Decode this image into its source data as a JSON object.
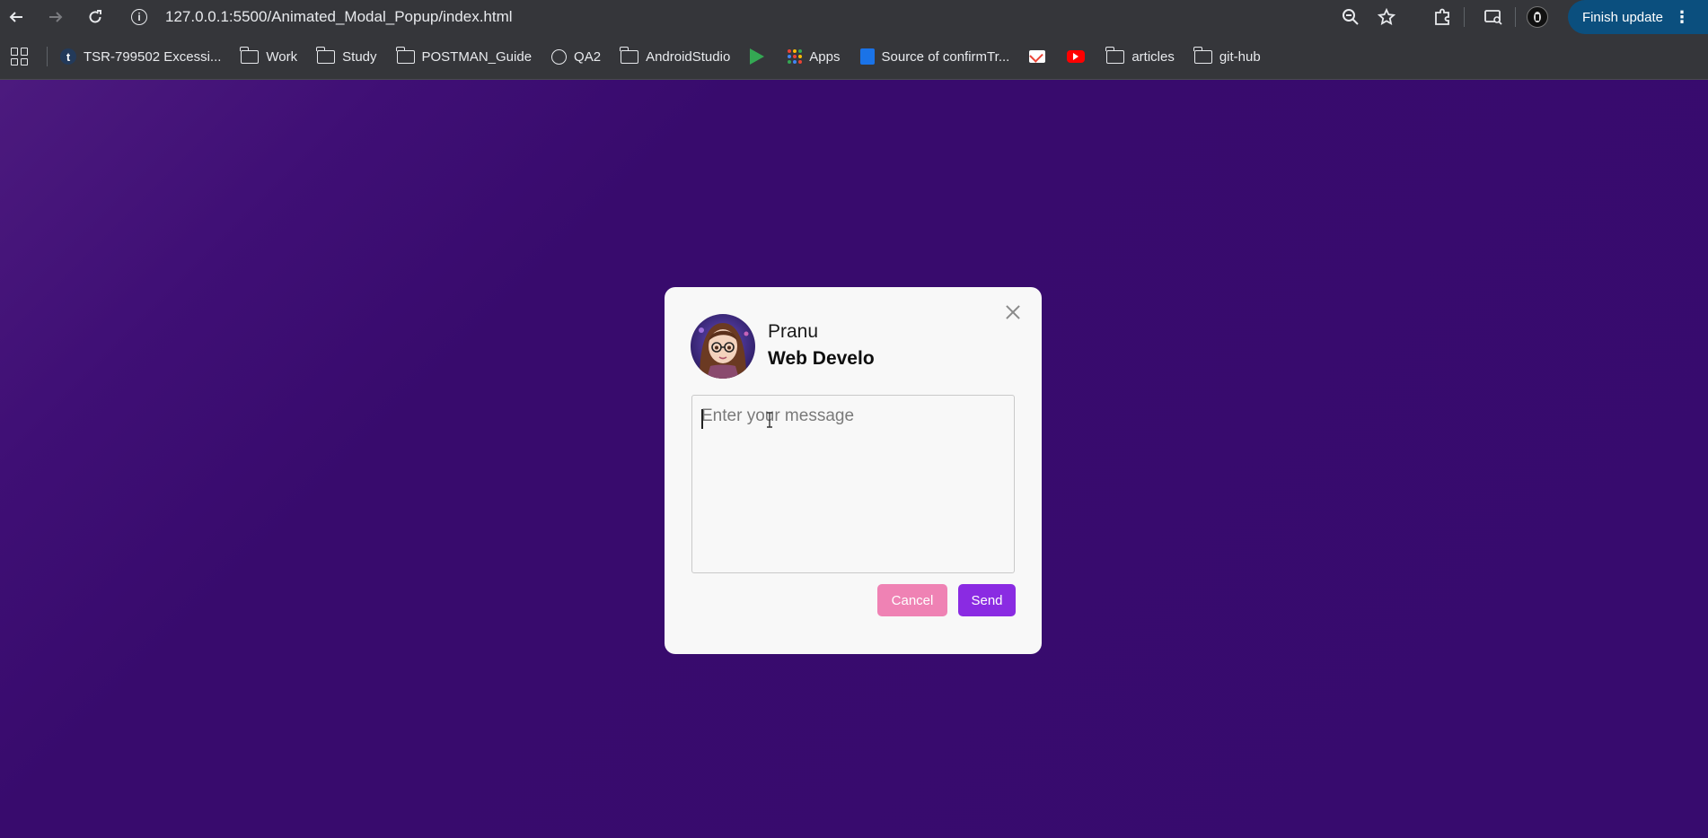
{
  "browser": {
    "url": "127.0.0.1:5500/Animated_Modal_Popup/index.html",
    "update_label": "Finish update",
    "icons": [
      "back-icon",
      "forward-icon",
      "reload-icon",
      "site-info-icon",
      "zoom-icon",
      "star-icon",
      "extensions-icon",
      "reading-list-icon",
      "profile-icon",
      "more-icon"
    ]
  },
  "bookmarks": [
    {
      "label": "TSR-799502 Excessi...",
      "icon": "tumblr-icon"
    },
    {
      "label": "Work",
      "icon": "folder-icon"
    },
    {
      "label": "Study",
      "icon": "folder-icon"
    },
    {
      "label": "POSTMAN_Guide",
      "icon": "folder-icon"
    },
    {
      "label": "QA2",
      "icon": "globe-icon"
    },
    {
      "label": "AndroidStudio",
      "icon": "folder-icon"
    },
    {
      "label": "",
      "icon": "play-store-icon"
    },
    {
      "label": "Apps",
      "icon": "apps-icon"
    },
    {
      "label": "Source of confirmTr...",
      "icon": "source-icon"
    },
    {
      "label": "",
      "icon": "gmail-icon"
    },
    {
      "label": "",
      "icon": "youtube-icon"
    },
    {
      "label": "articles",
      "icon": "folder-icon"
    },
    {
      "label": "git-hub",
      "icon": "folder-icon"
    }
  ],
  "modal": {
    "name": "Pranu",
    "role": "Web Develo",
    "message_placeholder": "Enter your message",
    "message_value": "",
    "cancel_label": "Cancel",
    "send_label": "Send"
  },
  "colors": {
    "background": "#370b6e",
    "cancel": "#ef82b4",
    "send": "#8a2be2",
    "update_button": "#0b4f7e"
  }
}
